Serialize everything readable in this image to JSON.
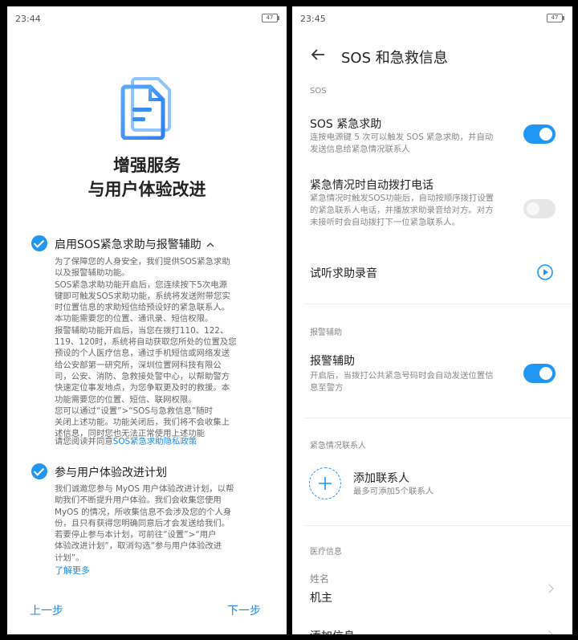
{
  "left_screen": {
    "status_time": "23:44",
    "battery": "47",
    "icon": "document-icon",
    "title_line1": "增强服务",
    "title_line2": "与用户体验改进",
    "section1": {
      "title": "启用SOS紧急求助与报警辅助",
      "expand_icon": "chevron-up-icon",
      "lines": [
        "为了保障您的人身安全，我们提供SOS紧急求助",
        "以及报警辅助功能。",
        "SOS紧急求助功能开启后，您连续按下5次电源",
        "键即可触发SOS求助功能，系统将发送附带您实",
        "时位置信息的求助短信给预设好的紧急联系人。",
        "本功能需要您的位置、通讯录、短信权限。",
        "报警辅助功能开启后，当您在拨打110、122、",
        "119、120时，系统将自动获取您所处的位置及您",
        "预设的个人医疗信息，通过手机短信或网络发送",
        "给公安部第一研究所，深圳位置网科技有限公",
        "司，公安、消防、急救接处警中心，以帮助警方",
        "快速定位事发地点，为您争取更及时的救援。本",
        "功能需要您的位置、短信、联网权限。",
        "您可以通过“设置”>“SOS与急救信息”随时",
        "关闭上述功能。功能关闭后，我们将不会收集上",
        "述信息，同时您也无法正常使用上述功能"
      ],
      "policy_prefix": "请您阅读并同意",
      "policy_link": "SOS紧急求助隐私政策"
    },
    "section2": {
      "title": "参与用户体验改进计划",
      "lines": [
        "我们诚邀您参与 MyOS 用户体验改进计划，以帮",
        "助我们不断提升用户体验。我们会收集您使用",
        "MyOS 的情况，所收集信息不会涉及您的个人身",
        "份，且只有获得您明确同意后才会发送给我们。",
        "若要停止参与本计划，可前往“设置”>“用户",
        "体验改进计划”，取消勾选“参与用户体验改进",
        "计划”。"
      ],
      "learn_more": "了解更多"
    },
    "prev": "上一步",
    "next": "下一步",
    "accent": "#2196f3"
  },
  "right_screen": {
    "status_time": "23:45",
    "battery": "47",
    "title": "SOS 和急救信息",
    "sos_section": "SOS",
    "sos_item": {
      "title": "SOS 紧急求助",
      "desc": "连按电源键 5 次可以触发 SOS 紧急求助，并自动发送信息给紧急情况联系人",
      "toggle": "on"
    },
    "auto_call": {
      "title": "紧急情况时自动拨打电话",
      "desc": "紧急情况时触发SOS功能后，自动按顺序拨打设置的紧急联系人电话，并播放求助录音给对方。对方未接听时会自动拨打下一位紧急联系人。",
      "toggle": "off"
    },
    "listen": {
      "title": "试听求助录音",
      "icon": "play-icon"
    },
    "alarm_section": "报警辅助",
    "alarm_item": {
      "title": "报警辅助",
      "desc": "开启后，当拨打公共紧急号码时会自动发送位置信息至警方",
      "toggle": "on"
    },
    "contact_section": "紧急情况联系人",
    "add_contact": {
      "title": "添加联系人",
      "sub": "最多可添加5个联系人",
      "icon": "plus-icon"
    },
    "medical_section": "医疗信息",
    "name_item": {
      "label": "姓名",
      "value": "机主"
    },
    "add_info": "添加信息"
  }
}
